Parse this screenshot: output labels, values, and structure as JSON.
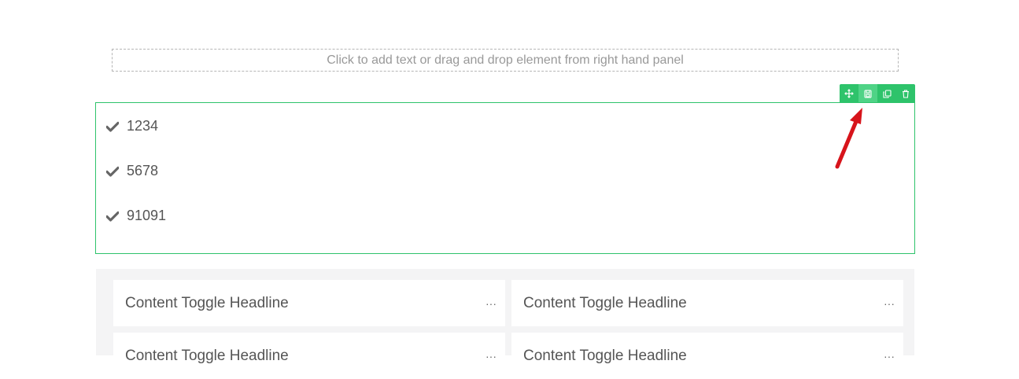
{
  "placeholder": {
    "text": "Click to add text or drag and drop element from right hand panel"
  },
  "toolbar": {
    "buttons": [
      {
        "icon": "move-icon"
      },
      {
        "icon": "save-icon"
      },
      {
        "icon": "duplicate-icon"
      },
      {
        "icon": "delete-icon"
      }
    ],
    "color": "#2ec36b"
  },
  "checklist": {
    "items": [
      {
        "label": "1234",
        "icon": "check-icon"
      },
      {
        "label": "5678",
        "icon": "check-icon"
      },
      {
        "label": "91091",
        "icon": "check-icon"
      }
    ]
  },
  "content_toggles": {
    "items": [
      {
        "title": "Content Toggle Headline",
        "menu": "···"
      },
      {
        "title": "Content Toggle Headline",
        "menu": "···"
      },
      {
        "title": "Content Toggle Headline",
        "menu": "···"
      },
      {
        "title": "Content Toggle Headline",
        "menu": "···"
      }
    ]
  },
  "annotation": {
    "arrow_color": "#d7141b"
  }
}
